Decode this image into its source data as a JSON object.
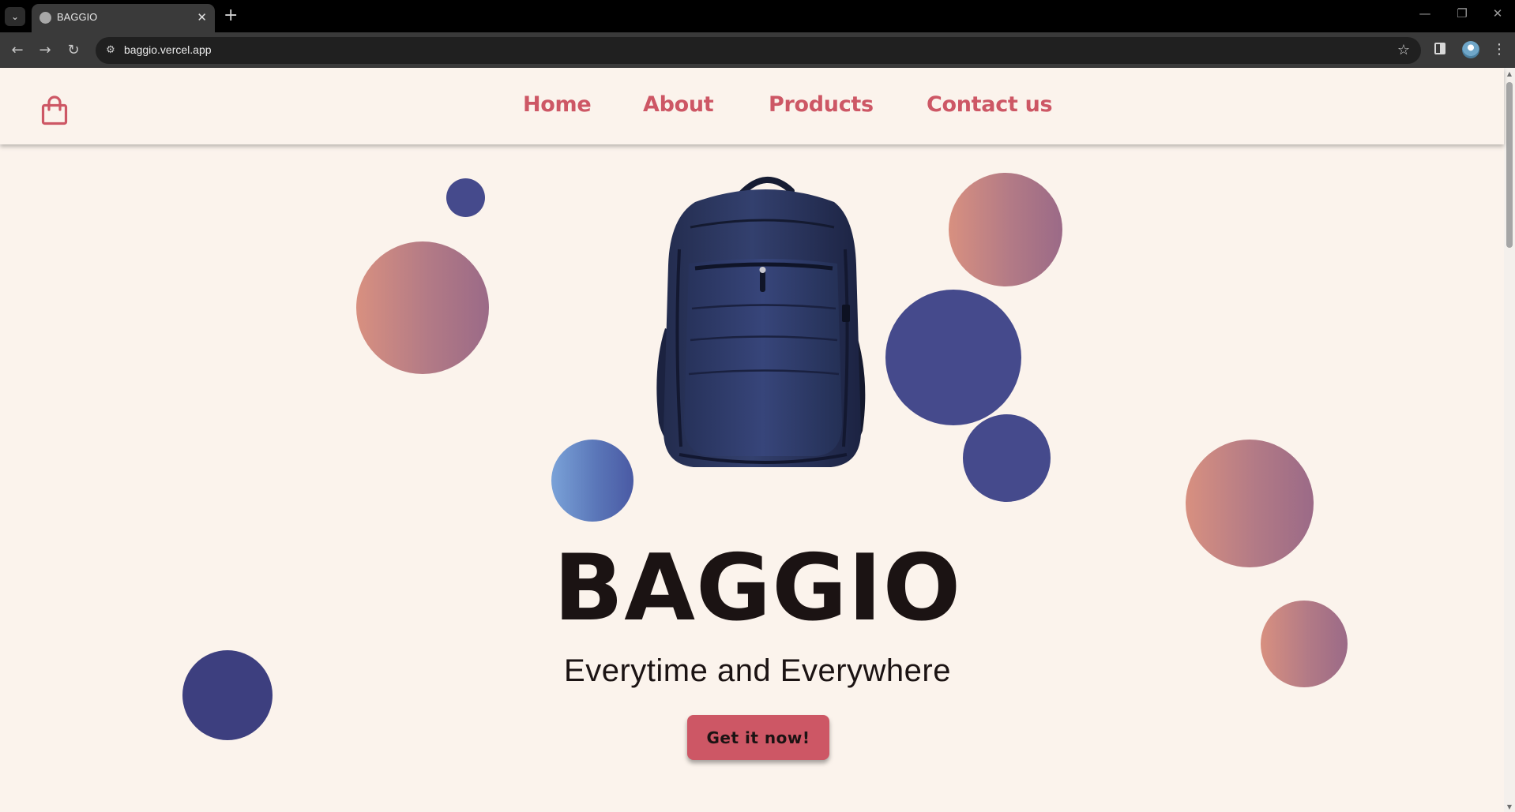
{
  "browser": {
    "tab_title": "BAGGIO",
    "tab_close": "✕",
    "new_tab": "+",
    "url": "baggio.vercel.app",
    "icons": {
      "tab_search": "chevron-down-icon",
      "favicon": "globe-icon",
      "back": "arrow-left-icon",
      "forward": "arrow-right-icon",
      "reload": "reload-icon",
      "site_info": "tune-icon",
      "bookmark": "star-icon",
      "side_panel": "side-panel-icon",
      "profile": "avatar",
      "menu": "more-vert-icon"
    }
  },
  "site": {
    "nav": {
      "home": "Home",
      "about": "About",
      "products": "Products",
      "contact": "Contact us"
    },
    "hero": {
      "title": "BAGGIO",
      "subtitle": "Everytime and Everywhere",
      "cta": "Get it now!"
    },
    "colors": {
      "background": "#fbf3ec",
      "accent": "#cd5765",
      "navy": "#454a8c",
      "text": "#1b1313"
    }
  }
}
